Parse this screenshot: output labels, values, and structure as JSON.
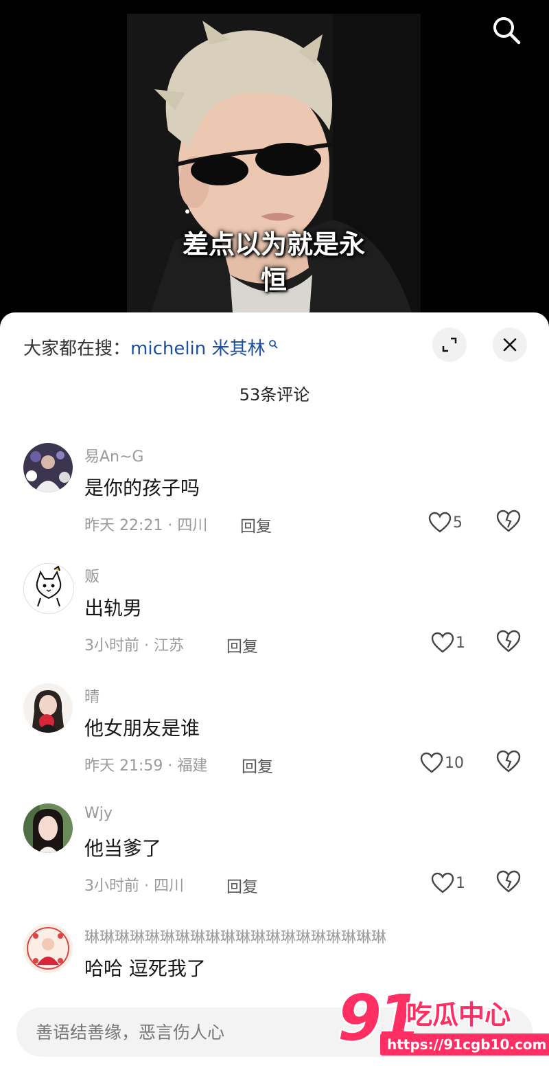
{
  "video": {
    "subtitle_line1": "差点以为就是永",
    "subtitle_line2": "恒",
    "search_icon": "search-icon"
  },
  "panel": {
    "hot_search_prefix": "大家都在搜：",
    "hot_search_keyword": "michelin 米其林",
    "expand_icon": "expand-icon",
    "close_icon": "close-icon",
    "comment_count": "53条评论"
  },
  "comments": [
    {
      "username": "易An~G",
      "text": "是你的孩子吗",
      "time": "昨天 22:21 · 四川",
      "reply": "回复",
      "likes": "5"
    },
    {
      "username": "贩",
      "text": "出轨男",
      "time": "3小时前 · 江苏",
      "reply": "回复",
      "likes": "1"
    },
    {
      "username": "晴",
      "text": "他女朋友是谁",
      "time": "昨天 21:59 · 福建",
      "reply": "回复",
      "likes": "10"
    },
    {
      "username": "Wjy",
      "text": "他当爹了",
      "time": "3小时前 · 四川",
      "reply": "回复",
      "likes": "1"
    },
    {
      "username": "琳琳琳琳琳琳琳琳琳琳琳琳琳琳琳琳琳琳琳琳",
      "text": "哈哈 逗死我了",
      "time": "",
      "reply": "",
      "likes": ""
    }
  ],
  "input": {
    "placeholder": "善语结善缘，恶言伤人心"
  },
  "watermark": {
    "brand_number": "91",
    "brand_text": "吃瓜中心",
    "url": "https://91cgb10.com"
  },
  "colors": {
    "keyword": "#1d4fa0",
    "watermark": "#ff2e63",
    "muted_text": "#9a9a9a"
  }
}
